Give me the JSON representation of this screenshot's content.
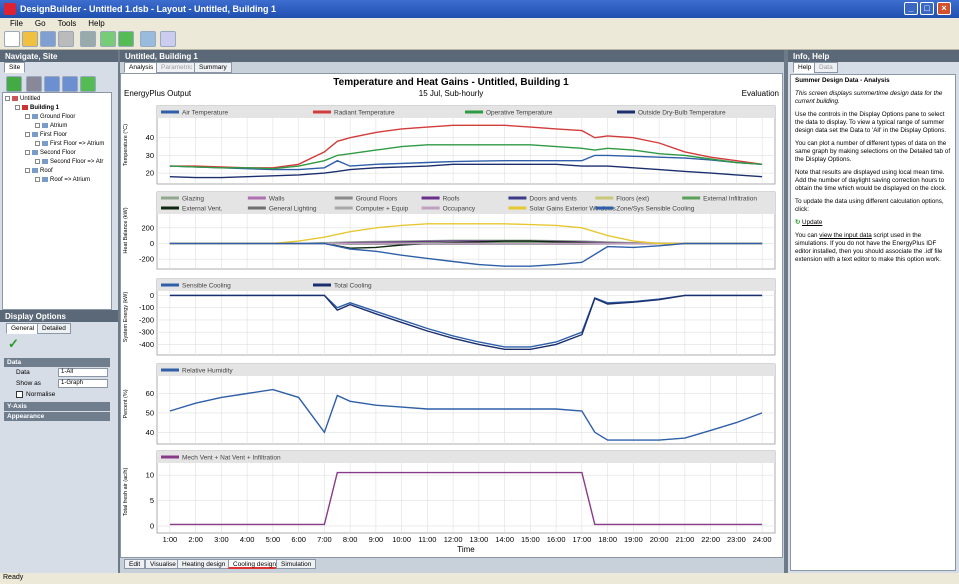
{
  "window": {
    "title": "DesignBuilder - Untitled 1.dsb - Layout - Untitled, Building 1"
  },
  "menu": [
    "File",
    "Go",
    "Tools",
    "Help"
  ],
  "left_panel": {
    "header": "Navigate, Site",
    "tab": "Site",
    "tree": [
      "Untitled",
      "Building 1",
      "Ground Floor",
      "Atrium",
      "First Floor",
      "First Floor => Atrium",
      "Second Floor",
      "Second Floor => Atr",
      "Roof",
      "Roof => Atrium"
    ]
  },
  "display_options": {
    "header": "Display Options",
    "tabs": [
      "General",
      "Detailed"
    ],
    "section_data": "Data",
    "data_label": "Data",
    "data_value": "1-All",
    "showas_label": "Show as",
    "showas_value": "1-Graph",
    "normalise_label": "Normalise",
    "section_yaxis": "Y-Axis",
    "section_appearance": "Appearance"
  },
  "center": {
    "header": "Untitled, Building 1",
    "tabs": [
      "Analysis",
      "Parametric",
      "Summary"
    ],
    "chart_title": "Temperature and Heat Gains - Untitled, Building 1",
    "left_caption": "EnergyPlus Output",
    "middle_caption": "15 Jul, Sub-hourly",
    "right_caption": "Evaluation",
    "bottom_tabs": [
      "Edit",
      "Visualise",
      "Heating design",
      "Cooling design",
      "Simulation"
    ]
  },
  "right_panel": {
    "header": "Info, Help",
    "tabs": [
      "Help",
      "Data"
    ],
    "title": "Summer Design Data - Analysis",
    "p1": "This screen displays summertime design data for the current building.",
    "p2": "Use the controls in the Display Options pane to select the data to display. To view a typical range of summer design data set the Data to 'All' in the Display Options.",
    "p3": "You can plot a number of different types of data on the same graph by making selections on the Detailed tab of the Display Options.",
    "p4": "Note that results are displayed using local mean time. Add the number of daylight saving correction hours to obtain the time which would be displayed on the clock.",
    "p5": "To update the data using different calculation options, click:",
    "update_link": "Update",
    "p6_pre": "You can ",
    "p6_link": "view the input data",
    "p6_post": " script used in the simulations. If you do not have the EnergyPlus IDF editor installed, then you should associate the .idf file extension with a text editor to make this option work."
  },
  "status": "Ready",
  "chart_data": [
    {
      "type": "line",
      "ylabel": "Temperature (°C)",
      "ylim": [
        15,
        50
      ],
      "yticks": [
        20,
        30,
        40
      ],
      "x": [
        1,
        2,
        3,
        4,
        5,
        6,
        7,
        7.5,
        8,
        9,
        10,
        11,
        12,
        13,
        14,
        15,
        16,
        17,
        17.5,
        18,
        19,
        20,
        21,
        22,
        23,
        24
      ],
      "series": [
        {
          "name": "Air Temperature",
          "color": "#2f5fa8",
          "values": [
            24,
            23.5,
            23,
            22.5,
            22,
            22,
            23,
            27,
            24,
            25,
            25.5,
            26,
            26.5,
            26.8,
            27,
            27,
            27,
            27,
            30,
            30,
            29.5,
            29,
            28.5,
            27.5,
            26,
            25
          ]
        },
        {
          "name": "Radiant Temperature",
          "color": "#d43b3b",
          "values": [
            24,
            24,
            23.5,
            23,
            23,
            25,
            32,
            38,
            40,
            43,
            45,
            46,
            47,
            47,
            47,
            46,
            45,
            44,
            40,
            41,
            40,
            37,
            32,
            29,
            27,
            25
          ]
        },
        {
          "name": "Operative Temperature",
          "color": "#2f9a45",
          "values": [
            24,
            23.5,
            23,
            23,
            22.5,
            24,
            27,
            30,
            31,
            33,
            35,
            36,
            36,
            36,
            36,
            36,
            35,
            34,
            33,
            34,
            33,
            31,
            30,
            28,
            26,
            25
          ]
        },
        {
          "name": "Outside Dry-Bulb Temperature",
          "color": "#1b2f6e",
          "values": [
            18,
            17.5,
            17.5,
            18,
            18.5,
            19,
            20,
            21,
            22,
            23,
            23.5,
            24,
            25,
            25,
            25,
            25,
            25,
            24,
            24,
            24,
            23,
            22,
            21,
            20,
            19,
            18
          ]
        }
      ]
    },
    {
      "type": "line",
      "ylabel": "Heat Balance (kW)",
      "ylim": [
        -300,
        350
      ],
      "yticks": [
        -200,
        0,
        200
      ],
      "x": [
        1,
        2,
        3,
        4,
        5,
        6,
        7,
        8,
        9,
        10,
        11,
        12,
        13,
        14,
        15,
        16,
        17,
        18,
        19,
        20,
        21,
        22,
        23,
        24
      ],
      "series": [
        {
          "name": "Glazing",
          "color": "#8fa88f",
          "values": [
            0,
            0,
            0,
            0,
            0,
            0,
            10,
            20,
            25,
            30,
            35,
            40,
            40,
            40,
            40,
            35,
            30,
            20,
            10,
            5,
            0,
            0,
            0,
            0
          ]
        },
        {
          "name": "Walls",
          "color": "#b06fb0",
          "values": [
            0,
            0,
            0,
            0,
            0,
            0,
            0,
            5,
            5,
            10,
            10,
            10,
            10,
            10,
            10,
            10,
            5,
            5,
            0,
            0,
            0,
            0,
            0,
            0
          ]
        },
        {
          "name": "Ground Floors",
          "color": "#8a8a8a",
          "values": [
            0,
            0,
            0,
            0,
            0,
            0,
            0,
            -10,
            -10,
            -10,
            -10,
            -10,
            -10,
            -10,
            -10,
            -10,
            -10,
            -5,
            0,
            0,
            0,
            0,
            0,
            0
          ]
        },
        {
          "name": "Roofs",
          "color": "#6a2f8a",
          "values": [
            0,
            0,
            0,
            0,
            0,
            0,
            0,
            10,
            15,
            20,
            25,
            30,
            30,
            30,
            30,
            25,
            20,
            10,
            5,
            0,
            0,
            0,
            0,
            0
          ]
        },
        {
          "name": "Doors and vents",
          "color": "#3b3b8a",
          "values": [
            0,
            0,
            0,
            0,
            0,
            0,
            0,
            0,
            0,
            0,
            0,
            0,
            0,
            0,
            0,
            0,
            0,
            0,
            0,
            0,
            0,
            0,
            0,
            0
          ]
        },
        {
          "name": "Floors (ext)",
          "color": "#c8c878",
          "values": [
            0,
            0,
            0,
            0,
            0,
            0,
            0,
            0,
            0,
            0,
            0,
            0,
            0,
            0,
            0,
            0,
            0,
            0,
            0,
            0,
            0,
            0,
            0,
            0
          ]
        },
        {
          "name": "External Infiltration",
          "color": "#5aa05a",
          "values": [
            0,
            0,
            0,
            0,
            0,
            0,
            0,
            -5,
            0,
            5,
            10,
            15,
            15,
            15,
            15,
            10,
            5,
            0,
            0,
            0,
            0,
            0,
            0,
            0
          ]
        },
        {
          "name": "External Vent.",
          "color": "#102810",
          "values": [
            0,
            0,
            0,
            0,
            0,
            0,
            0,
            -60,
            -50,
            -20,
            0,
            10,
            20,
            30,
            30,
            20,
            10,
            0,
            0,
            0,
            0,
            0,
            0,
            0
          ]
        },
        {
          "name": "General Lighting",
          "color": "#707070",
          "values": [
            0,
            0,
            0,
            0,
            0,
            0,
            0,
            0,
            0,
            0,
            0,
            0,
            0,
            0,
            0,
            0,
            0,
            0,
            0,
            0,
            0,
            0,
            0,
            0
          ]
        },
        {
          "name": "Computer + Equip",
          "color": "#a8a8a8",
          "values": [
            0,
            0,
            0,
            0,
            0,
            0,
            0,
            0,
            0,
            0,
            0,
            0,
            0,
            0,
            0,
            0,
            0,
            0,
            0,
            0,
            0,
            0,
            0,
            0
          ]
        },
        {
          "name": "Occupancy",
          "color": "#c0a0c0",
          "values": [
            0,
            0,
            0,
            0,
            0,
            0,
            0,
            0,
            0,
            0,
            0,
            0,
            0,
            0,
            0,
            0,
            0,
            0,
            0,
            0,
            0,
            0,
            0,
            0
          ]
        },
        {
          "name": "Solar Gains Exterior Windows",
          "color": "#e8c832",
          "values": [
            0,
            0,
            0,
            0,
            0,
            30,
            80,
            150,
            200,
            230,
            250,
            250,
            250,
            250,
            240,
            230,
            200,
            100,
            30,
            0,
            0,
            0,
            0,
            0
          ]
        },
        {
          "name": "Zone/Sys Sensible Cooling",
          "color": "#2f5fa8",
          "values": [
            0,
            0,
            0,
            0,
            0,
            0,
            0,
            -70,
            -100,
            -150,
            -190,
            -230,
            -270,
            -290,
            -290,
            -270,
            -240,
            -40,
            -50,
            -30,
            0,
            0,
            0,
            0
          ]
        }
      ]
    },
    {
      "type": "line",
      "ylabel": "System Energy (kW)",
      "ylim": [
        -470,
        20
      ],
      "yticks": [
        -400,
        -300,
        -200,
        -100,
        0
      ],
      "x": [
        1,
        2,
        3,
        4,
        5,
        6,
        7,
        7.5,
        8,
        9,
        10,
        11,
        12,
        13,
        14,
        15,
        16,
        17,
        17.5,
        18,
        19,
        20,
        21,
        22,
        23,
        24
      ],
      "series": [
        {
          "name": "Sensible Cooling",
          "color": "#2f5fa8",
          "values": [
            0,
            0,
            0,
            0,
            0,
            0,
            0,
            -100,
            -60,
            -130,
            -200,
            -270,
            -330,
            -380,
            -420,
            -420,
            -380,
            -300,
            -20,
            -60,
            -50,
            -30,
            0,
            0,
            0,
            0
          ]
        },
        {
          "name": "Total Cooling",
          "color": "#1b2f6e",
          "values": [
            0,
            0,
            0,
            0,
            0,
            0,
            0,
            -120,
            -75,
            -150,
            -220,
            -290,
            -350,
            -400,
            -440,
            -440,
            -400,
            -320,
            -25,
            -70,
            -55,
            -35,
            0,
            0,
            0,
            0
          ]
        }
      ]
    },
    {
      "type": "line",
      "ylabel": "Percent (%)",
      "ylim": [
        35,
        68
      ],
      "yticks": [
        40,
        50,
        60
      ],
      "x": [
        1,
        2,
        3,
        4,
        5,
        6,
        7,
        7.5,
        8,
        9,
        10,
        11,
        12,
        13,
        14,
        15,
        16,
        17,
        17.5,
        18,
        19,
        20,
        21,
        22,
        23,
        24
      ],
      "series": [
        {
          "name": "Relative Humidity",
          "color": "#2f5fa8",
          "values": [
            51,
            55,
            58,
            60,
            62,
            58,
            40,
            59,
            56,
            54,
            53,
            52,
            52,
            52,
            52,
            52,
            52,
            51,
            40,
            36,
            36,
            36,
            37,
            41,
            45,
            50
          ]
        }
      ]
    },
    {
      "type": "line",
      "ylabel": "Total fresh air (ac/h)",
      "ylim": [
        -1,
        12
      ],
      "yticks": [
        0,
        5,
        10
      ],
      "xlabel": "Time",
      "xticks": [
        "1:00",
        "2:00",
        "3:00",
        "4:00",
        "5:00",
        "6:00",
        "7:00",
        "8:00",
        "9:00",
        "10:00",
        "11:00",
        "12:00",
        "13:00",
        "14:00",
        "15:00",
        "16:00",
        "17:00",
        "18:00",
        "19:00",
        "20:00",
        "21:00",
        "22:00",
        "23:00",
        "24:00"
      ],
      "x": [
        1,
        7,
        7.5,
        17,
        17.5,
        24
      ],
      "series": [
        {
          "name": "Mech Vent + Nat Vent + Infiltration",
          "color": "#8a3a8a",
          "values": [
            0.3,
            0.3,
            10.5,
            10.5,
            0.3,
            0.3
          ]
        }
      ]
    }
  ]
}
